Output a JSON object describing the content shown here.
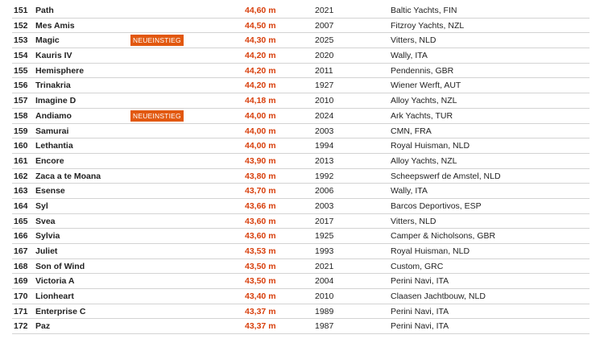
{
  "badge_label": "NEUEINSTIEG",
  "colors": {
    "badge_bg": "#e2580f",
    "length_text": "#d8400d",
    "divider": "#d3d3d3"
  },
  "rows": [
    {
      "rank": "151",
      "name": "Path",
      "badge": "",
      "length": "44,60 m",
      "year": "2021",
      "yard": "Baltic Yachts, FIN"
    },
    {
      "rank": "152",
      "name": "Mes Amis",
      "badge": "",
      "length": "44,50 m",
      "year": "2007",
      "yard": "Fitzroy Yachts, NZL"
    },
    {
      "rank": "153",
      "name": "Magic",
      "badge": "NEUEINSTIEG",
      "length": "44,30 m",
      "year": "2025",
      "yard": "Vitters, NLD"
    },
    {
      "rank": "154",
      "name": "Kauris IV",
      "badge": "",
      "length": "44,20 m",
      "year": "2020",
      "yard": "Wally, ITA"
    },
    {
      "rank": "155",
      "name": "Hemisphere",
      "badge": "",
      "length": "44,20 m",
      "year": "2011",
      "yard": "Pendennis, GBR"
    },
    {
      "rank": "156",
      "name": "Trinakria",
      "badge": "",
      "length": "44,20 m",
      "year": "1927",
      "yard": "Wiener Werft, AUT"
    },
    {
      "rank": "157",
      "name": "Imagine D",
      "badge": "",
      "length": "44,18 m",
      "year": "2010",
      "yard": "Alloy Yachts, NZL"
    },
    {
      "rank": "158",
      "name": "Andiamo",
      "badge": "NEUEINSTIEG",
      "length": "44,00 m",
      "year": "2024",
      "yard": "Ark Yachts, TUR"
    },
    {
      "rank": "159",
      "name": "Samurai",
      "badge": "",
      "length": "44,00 m",
      "year": "2003",
      "yard": "CMN, FRA"
    },
    {
      "rank": "160",
      "name": "Lethantia",
      "badge": "",
      "length": "44,00 m",
      "year": "1994",
      "yard": "Royal Huisman, NLD"
    },
    {
      "rank": "161",
      "name": "Encore",
      "badge": "",
      "length": "43,90 m",
      "year": "2013",
      "yard": "Alloy Yachts, NZL"
    },
    {
      "rank": "162",
      "name": "Zaca a te Moana",
      "badge": "",
      "length": "43,80 m",
      "year": "1992",
      "yard": "Scheepswerf de Amstel, NLD"
    },
    {
      "rank": "163",
      "name": "Esense",
      "badge": "",
      "length": "43,70 m",
      "year": "2006",
      "yard": "Wally, ITA"
    },
    {
      "rank": "164",
      "name": "Syl",
      "badge": "",
      "length": "43,66 m",
      "year": "2003",
      "yard": "Barcos Deportivos, ESP"
    },
    {
      "rank": "165",
      "name": "Svea",
      "badge": "",
      "length": "43,60 m",
      "year": "2017",
      "yard": "Vitters, NLD"
    },
    {
      "rank": "166",
      "name": "Sylvia",
      "badge": "",
      "length": "43,60 m",
      "year": "1925",
      "yard": "Camper & Nicholsons, GBR"
    },
    {
      "rank": "167",
      "name": "Juliet",
      "badge": "",
      "length": "43,53 m",
      "year": "1993",
      "yard": "Royal Huisman, NLD"
    },
    {
      "rank": "168",
      "name": "Son of Wind",
      "badge": "",
      "length": "43,50 m",
      "year": "2021",
      "yard": "Custom, GRC"
    },
    {
      "rank": "169",
      "name": "Victoria A",
      "badge": "",
      "length": "43,50 m",
      "year": "2004",
      "yard": "Perini Navi, ITA"
    },
    {
      "rank": "170",
      "name": "Lionheart",
      "badge": "",
      "length": "43,40 m",
      "year": "2010",
      "yard": "Claasen Jachtbouw, NLD"
    },
    {
      "rank": "171",
      "name": "Enterprise C",
      "badge": "",
      "length": "43,37 m",
      "year": "1989",
      "yard": "Perini Navi, ITA"
    },
    {
      "rank": "172",
      "name": "Paz",
      "badge": "",
      "length": "43,37 m",
      "year": "1987",
      "yard": "Perini Navi, ITA"
    }
  ]
}
